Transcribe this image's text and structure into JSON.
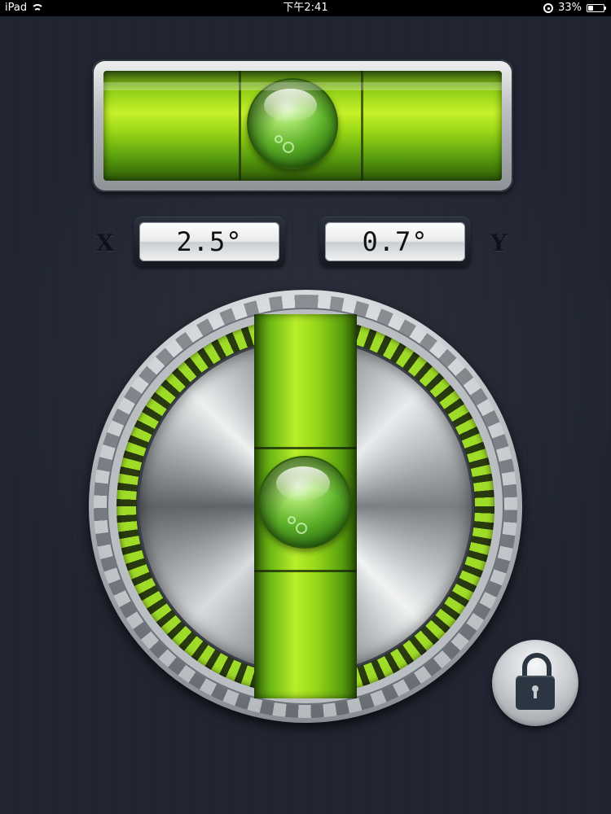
{
  "status_bar": {
    "device": "iPad",
    "time": "下午2:41",
    "battery_percent": "33%",
    "battery_level": 0.33
  },
  "readouts": {
    "x_label": "X",
    "y_label": "Y",
    "x_value": "2.5°",
    "y_value": "0.7°"
  },
  "icons": {
    "wifi": "wifi-icon",
    "rotation_lock": "rotation-lock-icon",
    "battery": "battery-icon",
    "lock": "lock-icon"
  },
  "colors": {
    "background": "#1f2430",
    "vial_green": "#9ad817",
    "bubble_green": "#5fb22a",
    "lock_dark": "#2c3542"
  }
}
